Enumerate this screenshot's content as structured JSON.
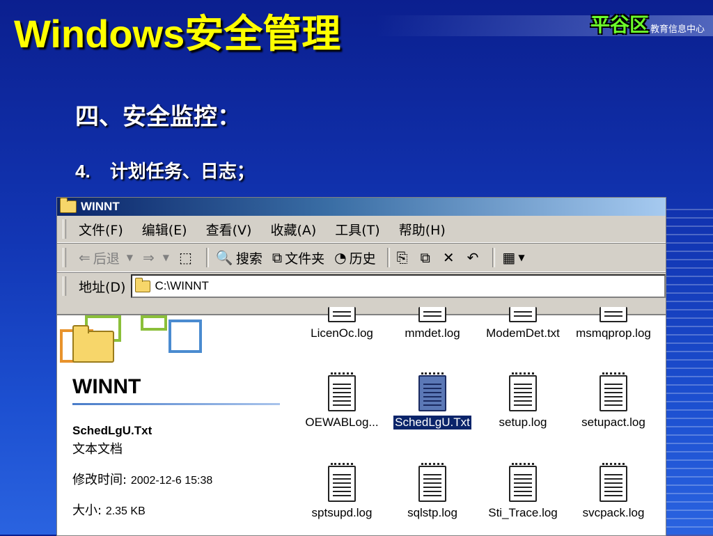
{
  "slide": {
    "title": "Windows安全管理",
    "logo_main": "平谷区",
    "logo_sub": "教育信息中心",
    "section_heading": "四、安全监控：",
    "sub_number": "4.",
    "sub_text": "计划任务、日志；"
  },
  "window": {
    "title": "WINNT",
    "menu": [
      "文件(F)",
      "编辑(E)",
      "查看(V)",
      "收藏(A)",
      "工具(T)",
      "帮助(H)"
    ],
    "toolbar": {
      "back": "后退",
      "search": "搜索",
      "folders": "文件夹",
      "history": "历史"
    },
    "address_label": "地址(D)",
    "address_value": "C:\\WINNT"
  },
  "details_pane": {
    "folder_name": "WINNT",
    "selected_file": "SchedLgU.Txt",
    "file_type": "文本文档",
    "modified_label": "修改时间:",
    "modified_value": "2002-12-6 15:38",
    "size_label": "大小:",
    "size_value": "2.35 KB"
  },
  "files": [
    {
      "name": "LicenOc.log",
      "selected": false
    },
    {
      "name": "mmdet.log",
      "selected": false
    },
    {
      "name": "ModemDet.txt",
      "selected": false
    },
    {
      "name": "msmqprop.log",
      "selected": false
    },
    {
      "name": "OEWABLog...",
      "selected": false
    },
    {
      "name": "SchedLgU.Txt",
      "selected": true
    },
    {
      "name": "setup.log",
      "selected": false
    },
    {
      "name": "setupact.log",
      "selected": false
    },
    {
      "name": "sptsupd.log",
      "selected": false
    },
    {
      "name": "sqlstp.log",
      "selected": false
    },
    {
      "name": "Sti_Trace.log",
      "selected": false
    },
    {
      "name": "svcpack.log",
      "selected": false
    }
  ],
  "colors": {
    "title_yellow": "#ffff00",
    "selection_blue": "#0a246a",
    "logo_green": "#6cff2a"
  }
}
